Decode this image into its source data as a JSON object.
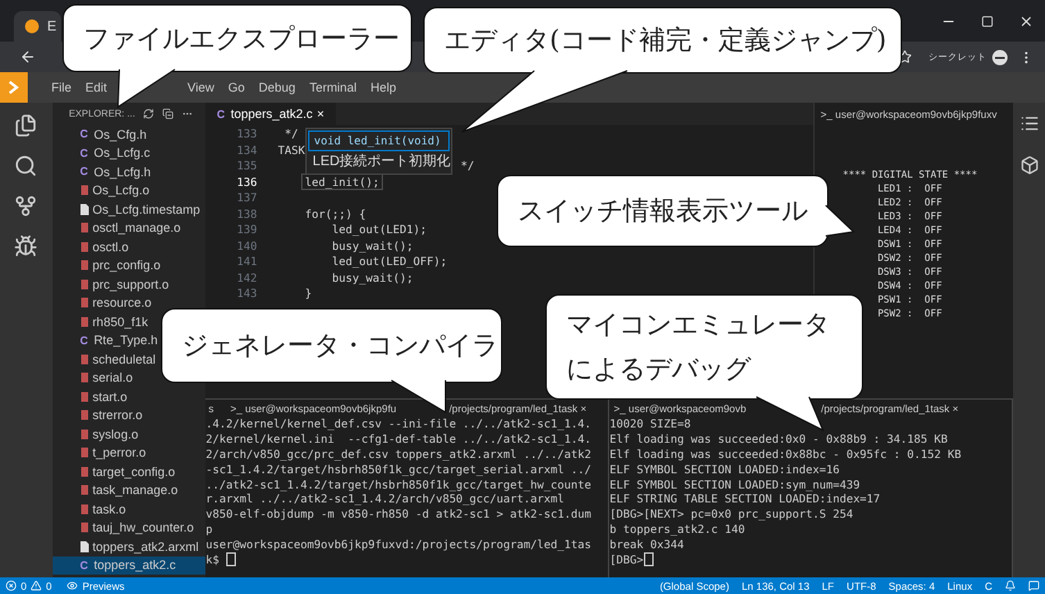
{
  "browser": {
    "tab_title": "E",
    "incognito_label": "シークレット"
  },
  "menu": [
    "File",
    "Edit",
    "View",
    "Go",
    "Debug",
    "Terminal",
    "Help"
  ],
  "explorer": {
    "title": "EXPLORER: ...",
    "files": [
      {
        "icon": "C",
        "name": "Os_Cfg.h",
        "kind": "source",
        "selected": false
      },
      {
        "icon": "C",
        "name": "Os_Lcfg.c",
        "kind": "source",
        "selected": false
      },
      {
        "icon": "C",
        "name": "Os_Lcfg.h",
        "kind": "source",
        "selected": false
      },
      {
        "name": "Os_Lcfg.o",
        "kind": "object",
        "selected": false
      },
      {
        "name": "Os_Lcfg.timestamp",
        "kind": "document",
        "selected": false
      },
      {
        "name": "osctl_manage.o",
        "kind": "object",
        "selected": false
      },
      {
        "name": "osctl.o",
        "kind": "object",
        "selected": false
      },
      {
        "name": "prc_config.o",
        "kind": "object",
        "selected": false
      },
      {
        "name": "prc_support.o",
        "kind": "object",
        "selected": false
      },
      {
        "name": "resource.o",
        "kind": "object",
        "selected": false
      },
      {
        "name": "rh850_f1k",
        "kind": "object",
        "selected": false
      },
      {
        "icon": "C",
        "name": "Rte_Type.h",
        "kind": "source",
        "selected": false
      },
      {
        "name": "scheduletal",
        "kind": "object",
        "selected": false
      },
      {
        "name": "serial.o",
        "kind": "object",
        "selected": false
      },
      {
        "name": "start.o",
        "kind": "object",
        "selected": false
      },
      {
        "name": "strerror.o",
        "kind": "object",
        "selected": false
      },
      {
        "name": "syslog.o",
        "kind": "object",
        "selected": false
      },
      {
        "name": "t_perror.o",
        "kind": "object",
        "selected": false
      },
      {
        "name": "target_config.o",
        "kind": "object",
        "selected": false
      },
      {
        "name": "task_manage.o",
        "kind": "object",
        "selected": false
      },
      {
        "name": "task.o",
        "kind": "object",
        "selected": false
      },
      {
        "name": "tauj_hw_counter.o",
        "kind": "object",
        "selected": false
      },
      {
        "name": "toppers_atk2.arxml",
        "kind": "document",
        "selected": false
      },
      {
        "icon": "C",
        "name": "toppers_atk2.c",
        "kind": "source",
        "selected": true
      }
    ]
  },
  "editor": {
    "tab": {
      "icon": "C",
      "title": "toppers_atk2.c",
      "close": "×"
    },
    "hint": {
      "signature": "void led_init(void)",
      "description": "LED接続ポート初期化"
    },
    "lines": [
      {
        "number": "133",
        "code": " */",
        "current": false
      },
      {
        "number": "134",
        "code": "TASK",
        "current": false
      },
      {
        "number": "135",
        "code": "                           */",
        "current": false
      },
      {
        "number": "136",
        "code": "    led_init();",
        "current": true
      },
      {
        "number": "137",
        "current": false
      },
      {
        "number": "138",
        "code": "    for(;;) {",
        "current": false
      },
      {
        "number": "139",
        "code": "        led_out(LED1);",
        "current": false
      },
      {
        "number": "140",
        "code": "        busy_wait();",
        "current": false
      },
      {
        "number": "141",
        "code": "        led_out(LED_OFF);",
        "current": false
      },
      {
        "number": "142",
        "code": "        busy_wait();",
        "current": false
      },
      {
        "number": "143",
        "code": "    }",
        "current": false
      }
    ]
  },
  "state_panel": {
    "tab": ">_ user@workspaceom9ovb6jkp9fuxv",
    "lines": [
      "**** DIGITAL STATE ****",
      "      LED1 :  OFF",
      "      LED2 :  OFF",
      "      LED3 :  OFF",
      "      LED4 :  OFF",
      "      DSW1 :  OFF",
      "      DSW2 :  OFF",
      "      DSW3 :  OFF",
      "      DSW4 :  OFF",
      "      PSW1 :  OFF",
      "      PSW2 :  OFF"
    ]
  },
  "terminals": [
    {
      "lead": "s",
      "tab_start": ">_ user@workspaceom9ovb6jkp9fu",
      "tab_end": "/projects/program/led_1task ×",
      "lines": [
        ".4.2/kernel/kernel_def.csv --ini-file ../../atk2-sc1_1.4.",
        "2/kernel/kernel.ini  --cfg1-def-table ../../atk2-sc1_1.4.",
        "2/arch/v850_gcc/prc_def.csv toppers_atk2.arxml ../../atk2",
        "-sc1_1.4.2/target/hsbrh850f1k_gcc/target_serial.arxml ../",
        "../atk2-sc1_1.4.2/target/hsbrh850f1k_gcc/target_hw_counte",
        "r.arxml ../../atk2-sc1_1.4.2/arch/v850_gcc/uart.arxml",
        "v850-elf-objdump -m v850-rh850 -d atk2-sc1 > atk2-sc1.dum",
        "p",
        "user@workspaceom9ovb6jkp9fuxvd:/projects/program/led_1tas",
        "k$ "
      ]
    },
    {
      "tab_start": ">_ user@workspaceom9ovb",
      "tab_end": "/projects/program/led_1task ×",
      "lines": [
        "10020 SIZE=8",
        "Elf loading was succeeded:0x0 - 0x88b9 : 34.185 KB",
        "Elf loading was succeeded:0x88bc - 0x95fc : 0.152 KB",
        "ELF SYMBOL SECTION LOADED:index=16",
        "ELF SYMBOL SECTION LOADED:sym_num=439",
        "ELF STRING TABLE SECTION LOADED:index=17",
        "[DBG>[NEXT> pc=0x0 prc_support.S 254",
        "b toppers_atk2.c 140",
        "break 0x344",
        "[DBG>"
      ]
    }
  ],
  "status_bar": {
    "errors": "0",
    "warnings": "0",
    "previews": "Previews",
    "right": [
      "(Global Scope)",
      "Ln 136, Col 13",
      "LF",
      "UTF-8",
      "Spaces: 4",
      "Linux",
      "C"
    ]
  },
  "callouts": [
    {
      "lines": [
        "ファイルエクスプローラー"
      ]
    },
    {
      "lines": [
        "エディタ(コード補完・定義ジャンプ)"
      ]
    },
    {
      "lines": [
        "スイッチ情報表示ツール"
      ]
    },
    {
      "lines": [
        "ジェネレータ・コンパイラ"
      ]
    },
    {
      "lines": [
        "マイコンエミュレータ",
        "によるデバッグ"
      ]
    }
  ]
}
